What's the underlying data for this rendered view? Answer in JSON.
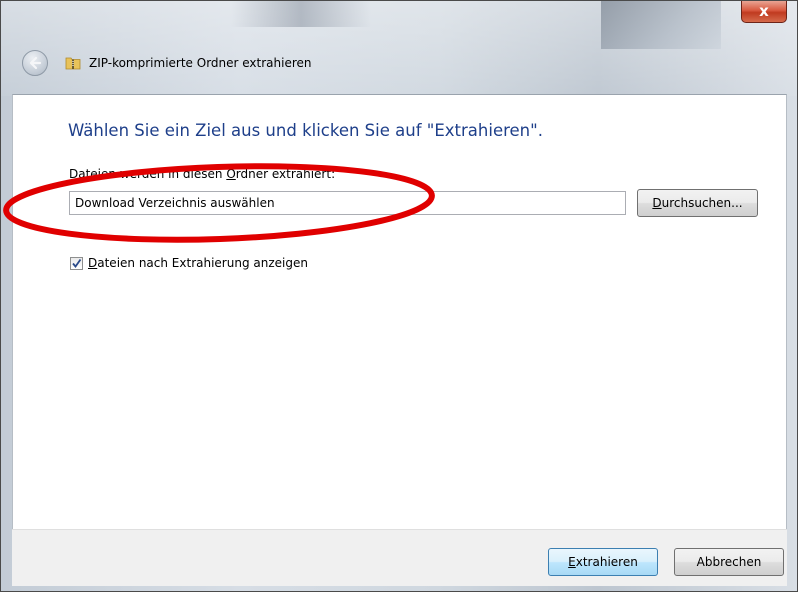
{
  "window": {
    "title": "ZIP-komprimierte Ordner extrahieren",
    "close_glyph": "x",
    "back_icon": "back-arrow-icon",
    "title_icon": "zip-folder-icon"
  },
  "main": {
    "heading": "Wählen Sie ein Ziel aus und klicken Sie auf \"Extrahieren\".",
    "folder_label": {
      "before": "Dateien werden in diesen ",
      "underlined": "O",
      "after": "rdner extrahiert:"
    },
    "path_value": "Download Verzeichnis auswählen",
    "browse_button": {
      "underlined": "D",
      "rest": "urchsuchen..."
    },
    "show_files_checkbox": {
      "checked": true,
      "label_underlined": "D",
      "label_rest": "ateien nach Extrahierung anzeigen"
    }
  },
  "footer": {
    "extract_button": {
      "underlined": "E",
      "rest": "xtrahieren"
    },
    "cancel_button": "Abbrechen"
  },
  "colors": {
    "heading": "#1e3f8a",
    "annotation_ellipse": "#e00000",
    "close_button": "#c8452c"
  }
}
